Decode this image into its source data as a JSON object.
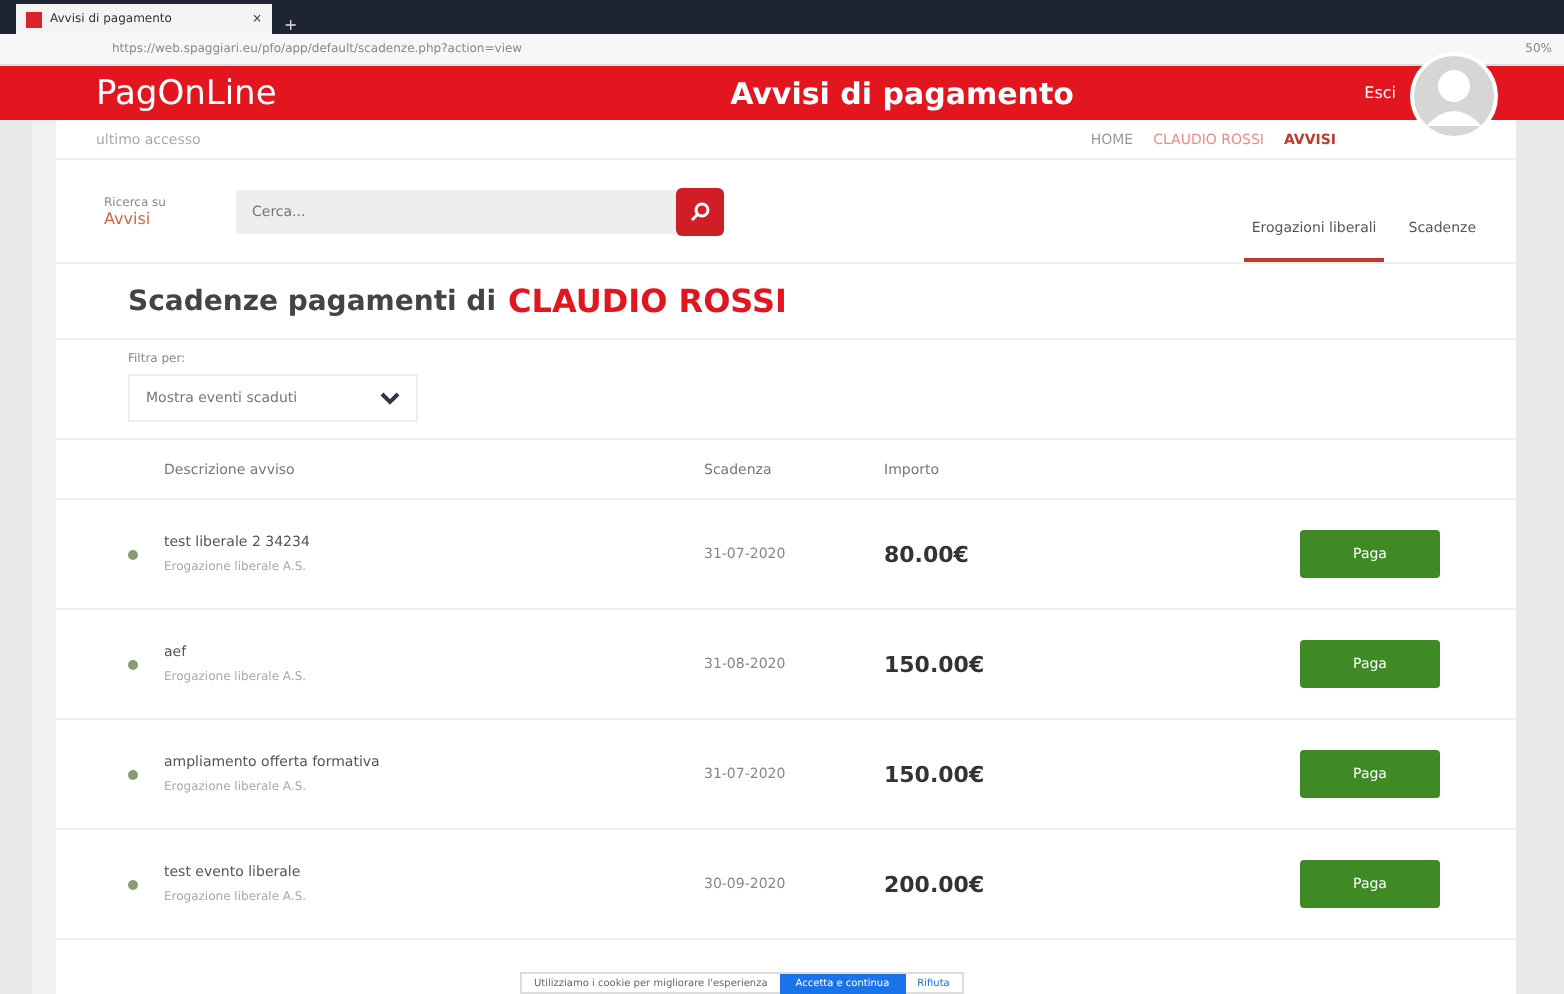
{
  "browser": {
    "tab_title": "Avvisi di pagamento",
    "tab_close": "×",
    "new_tab": "+",
    "url": "https://web.spaggiari.eu/pfo/app/default/scadenze.php?action=view",
    "zoom": "50%"
  },
  "header": {
    "logo": "PagOnLine",
    "title": "Avvisi di pagamento",
    "logout": "Esci"
  },
  "breadcrumb": {
    "left": "ultimo accesso",
    "links": [
      "HOME",
      "CLAUDIO ROSSI",
      "AVVISI"
    ]
  },
  "search": {
    "label": "Ricerca su",
    "scope": "Avvisi",
    "placeholder": "Cerca..."
  },
  "tabs": [
    {
      "label": "Erogazioni liberali",
      "selected": true
    },
    {
      "label": "Scadenze",
      "selected": false
    }
  ],
  "heading": {
    "prefix": "Scadenze pagamenti di",
    "name": "CLAUDIO ROSSI"
  },
  "filter": {
    "label": "Filtra per:",
    "value": "Mostra eventi scaduti"
  },
  "table": {
    "columns": [
      "Descrizione avviso",
      "Scadenza",
      "Importo"
    ],
    "rows": [
      {
        "title": "test liberale 2 34234",
        "subtitle": "Erogazione liberale A.S.",
        "due": "31-07-2020",
        "amount": "80.00€",
        "action": "Paga"
      },
      {
        "title": "aef",
        "subtitle": "Erogazione liberale A.S.",
        "due": "31-08-2020",
        "amount": "150.00€",
        "action": "Paga"
      },
      {
        "title": "ampliamento offerta formativa",
        "subtitle": "Erogazione liberale A.S.",
        "due": "31-07-2020",
        "amount": "150.00€",
        "action": "Paga"
      },
      {
        "title": "test evento liberale",
        "subtitle": "Erogazione liberale A.S.",
        "due": "30-09-2020",
        "amount": "200.00€",
        "action": "Paga"
      }
    ]
  },
  "cookie_bar": {
    "text": "Utilizziamo i cookie per migliorare l'esperienza",
    "accept": "Accetta e continua",
    "reject": "Rifiuta"
  }
}
